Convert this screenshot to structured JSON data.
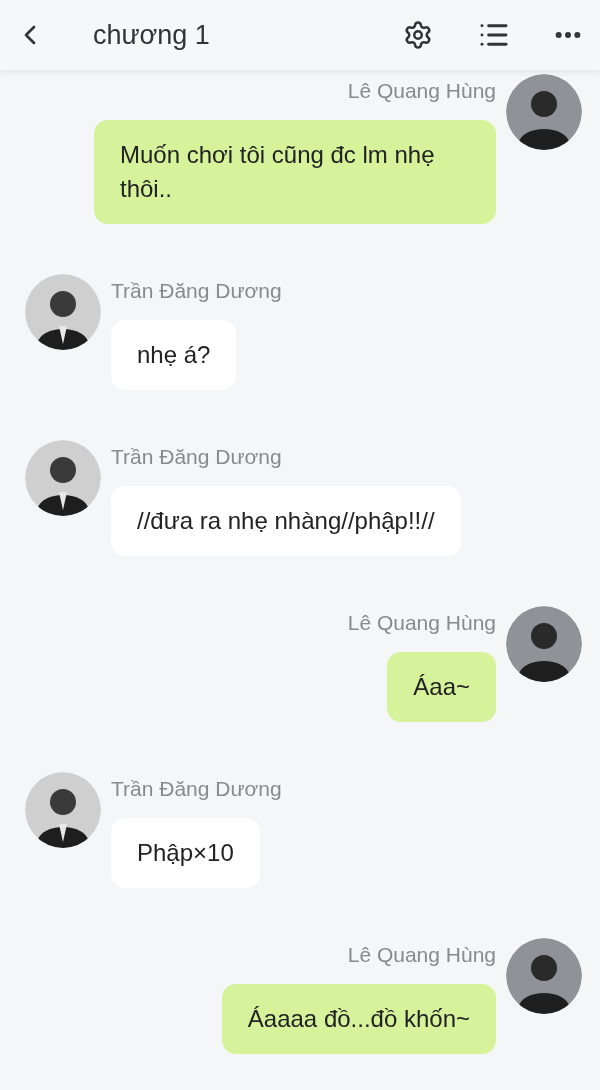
{
  "header": {
    "title": "chương 1"
  },
  "messages": [
    {
      "kind": "sent",
      "sender": "Lê Quang Hùng",
      "text": "Muốn chơi tôi cũng đc lm nhẹ thôi.."
    },
    {
      "kind": "received",
      "sender": "Trần Đăng Dương",
      "text": "nhẹ á?"
    },
    {
      "kind": "received",
      "sender": "Trần Đăng Dương",
      "text": "//đưa ra nhẹ nhàng//phập!!//"
    },
    {
      "kind": "sent",
      "sender": "Lê Quang Hùng",
      "text": "Áaa~"
    },
    {
      "kind": "received",
      "sender": "Trần Đăng Dương",
      "text": "Phập×10"
    },
    {
      "kind": "sent",
      "sender": "Lê Quang Hùng",
      "text": "Áaaaa đồ...đồ khốn~"
    }
  ]
}
